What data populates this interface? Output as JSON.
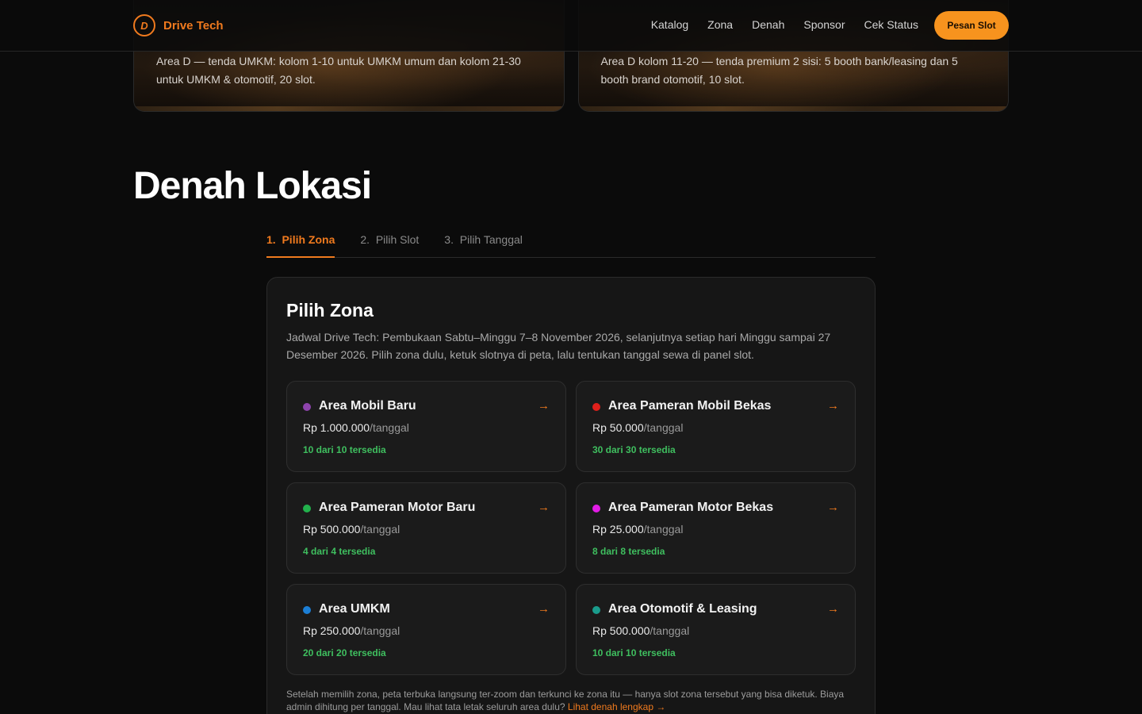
{
  "nav": {
    "brand": "Drive Tech",
    "logo_letter": "D",
    "menu": [
      "Katalog",
      "Zona",
      "Denah",
      "Sponsor",
      "Cek Status"
    ],
    "cta": "Pesan Slot"
  },
  "top_cards": [
    {
      "text": "Area D — tenda UMKM: kolom 1-10 untuk UMKM umum dan kolom 21-30 untuk UMKM & otomotif, 20 slot."
    },
    {
      "text": "Area D kolom 11-20 — tenda premium 2 sisi: 5 booth bank/leasing dan 5 booth brand otomotif, 10 slot."
    }
  ],
  "page_title": "Denah Lokasi",
  "steps": [
    {
      "num": "1.",
      "label": "Pilih Zona"
    },
    {
      "num": "2.",
      "label": "Pilih Slot"
    },
    {
      "num": "3.",
      "label": "Pilih Tanggal"
    }
  ],
  "panel": {
    "title": "Pilih Zona",
    "description": "Jadwal Drive Tech: Pembukaan Sabtu–Minggu 7–8 November 2026, selanjutnya setiap hari Minggu sampai 27 Desember 2026. Pilih zona dulu, ketuk slotnya di peta, lalu tentukan tanggal sewa di panel slot.",
    "zones": [
      {
        "name": "Area Mobil Baru",
        "price": "Rp 1.000.000",
        "unit": "/tanggal",
        "availability": "10 dari 10 tersedia",
        "color": "#8e44ad"
      },
      {
        "name": "Area Pameran Mobil Bekas",
        "price": "Rp 50.000",
        "unit": "/tanggal",
        "availability": "30 dari 30 tersedia",
        "color": "#e0201b"
      },
      {
        "name": "Area Pameran Motor Baru",
        "price": "Rp 500.000",
        "unit": "/tanggal",
        "availability": "4 dari 4 tersedia",
        "color": "#22b14c"
      },
      {
        "name": "Area Pameran Motor Bekas",
        "price": "Rp 25.000",
        "unit": "/tanggal",
        "availability": "8 dari 8 tersedia",
        "color": "#e21ce6"
      },
      {
        "name": "Area UMKM",
        "price": "Rp 250.000",
        "unit": "/tanggal",
        "availability": "20 dari 20 tersedia",
        "color": "#1c7fd6"
      },
      {
        "name": "Area Otomotif & Leasing",
        "price": "Rp 500.000",
        "unit": "/tanggal",
        "availability": "10 dari 10 tersedia",
        "color": "#1a9c8c"
      }
    ],
    "note": "Setelah memilih zona, peta terbuka langsung ter-zoom dan terkunci ke zona itu — hanya slot zona tersebut yang bisa diketuk. Biaya admin dihitung per tanggal. Mau lihat tata letak seluruh area dulu?",
    "note_link": "Lihat denah lengkap →"
  },
  "colors": {
    "accent": "#f07a1e",
    "cta": "#f7931e",
    "available": "#3fbf5f"
  }
}
